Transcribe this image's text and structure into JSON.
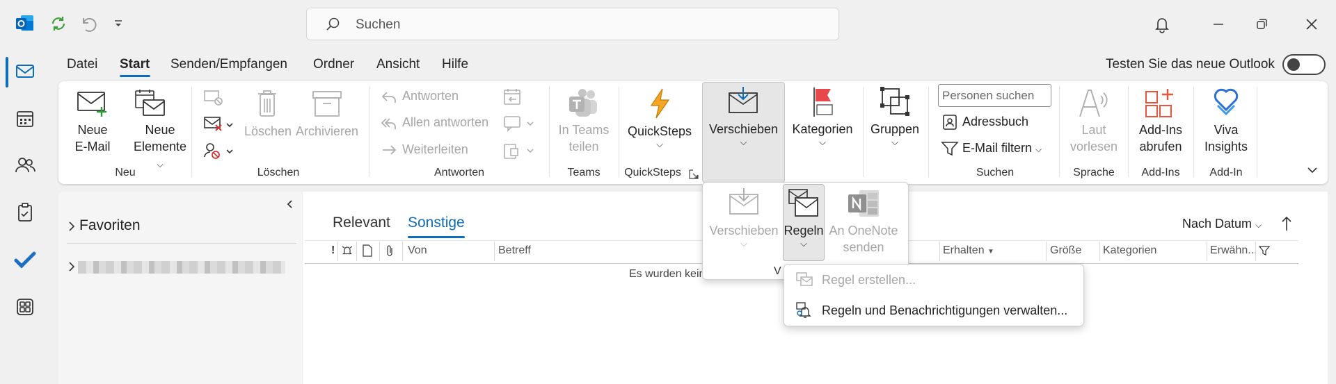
{
  "titlebar": {
    "search_placeholder": "Suchen"
  },
  "menu": {
    "items": [
      "Datei",
      "Start",
      "Senden/Empfangen",
      "Ordner",
      "Ansicht",
      "Hilfe"
    ],
    "selected": "Start",
    "new_outlook_label": "Testen Sie das neue Outlook"
  },
  "ribbon": {
    "neu": {
      "new_mail": [
        "Neue",
        "E-Mail"
      ],
      "new_items": [
        "Neue",
        "Elemente"
      ],
      "group": "Neu"
    },
    "loeschen": {
      "delete": "Löschen",
      "archive": "Archivieren",
      "group": "Löschen"
    },
    "antworten": {
      "reply": "Antworten",
      "reply_all": "Allen antworten",
      "forward": "Weiterleiten",
      "group": "Antworten"
    },
    "teams": {
      "share": [
        "In Teams",
        "teilen"
      ],
      "group": "Teams"
    },
    "quicksteps": {
      "label": "QuickSteps",
      "group": "QuickSteps"
    },
    "verschieben": {
      "label": "Verschieben"
    },
    "kategorien": {
      "label": "Kategorien"
    },
    "gruppen": {
      "label": "Gruppen"
    },
    "suchen": {
      "people_placeholder": "Personen suchen",
      "address_book": "Adressbuch",
      "filter": "E-Mail filtern",
      "group": "Suchen"
    },
    "sprache": {
      "read_aloud": [
        "Laut",
        "vorlesen"
      ],
      "group": "Sprache"
    },
    "addins": {
      "get": [
        "Add-Ins",
        "abrufen"
      ],
      "group": "Add-Ins"
    },
    "viva": {
      "label": [
        "Viva",
        "Insights"
      ],
      "group": "Add-In"
    }
  },
  "left_pane": {
    "favorites": "Favoriten"
  },
  "mail_list": {
    "tabs": [
      "Relevant",
      "Sonstige"
    ],
    "active_tab": "Sonstige",
    "sort": "Nach Datum",
    "columns": [
      "Von",
      "Betreff",
      "Erhalten",
      "Größe",
      "Kategorien",
      "Erwähn..."
    ],
    "empty_text": "Es wurden kein"
  },
  "flyout": {
    "move": "Verschieben",
    "rules": "Regeln",
    "onenote": [
      "An OneNote",
      "senden"
    ],
    "partial_label": "V"
  },
  "context_menu": {
    "items": [
      "Regel erstellen...",
      "Regeln und Benachrichtigungen verwalten..."
    ]
  },
  "colors": {
    "accent": "#0f6cbd",
    "flag_red": "#e8474c",
    "quicksteps": "#f5a623"
  }
}
